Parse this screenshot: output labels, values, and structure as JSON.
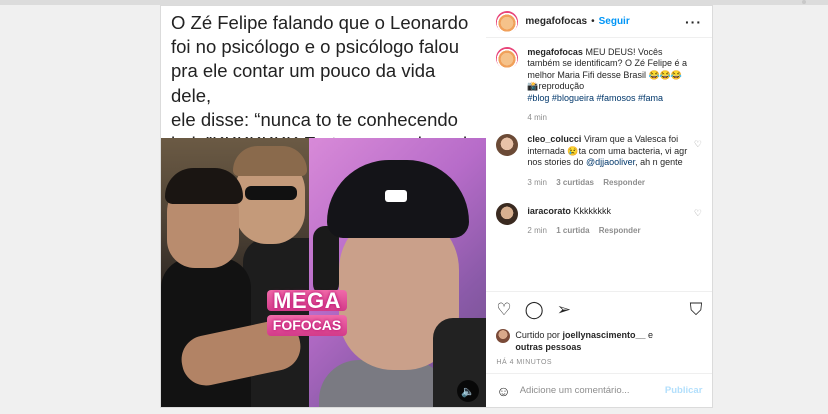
{
  "media": {
    "caption_lines": [
      "O Zé Felipe falando que o Leonardo",
      "foi no psicólogo e o psicólogo falou",
      "pra ele contar um pouco da vida dele,",
      "ele disse: “nunca to te conhecendo",
      "hoje”KKKKKKK Eu to passando mal"
    ],
    "watermark_line1": "MEGA",
    "watermark_line2": "FOFOCAS",
    "sound_icon": "🔈"
  },
  "header": {
    "username": "megafofocas",
    "dot": "•",
    "follow_label": "Seguir",
    "more_icon": "···"
  },
  "post_caption": {
    "username": "megafofocas",
    "text": "MEU DEUS! Vocês também se identificam? O Zé Felipe é a melhor Maria Fifi desse Brasil 😂😂😂",
    "repost": "📸reprodução",
    "hashtags": "#blog #blogueira #famosos #fama",
    "time": "4 min"
  },
  "comments": [
    {
      "username": "cleo_colucci",
      "text_before": "Viram que a Valesca foi internada 😢ta com uma bacteria, vi agr nos stories do",
      "mention": "@djjaooliver",
      "text_after": ", ah n gente",
      "time": "3 min",
      "likes": "3 curtidas",
      "reply": "Responder"
    },
    {
      "username": "iaracorato",
      "text": "Kkkkkkkk",
      "time": "2 min",
      "likes": "1 curtida",
      "reply": "Responder"
    }
  ],
  "actions": {
    "liked_prefix": "Curtido por",
    "liked_user": "joellynascimento__",
    "liked_mid": "e",
    "liked_others": "outras pessoas",
    "time": "HÁ 4 MINUTOS"
  },
  "add_comment": {
    "emoji_icon": "☺",
    "placeholder": "Adicione um comentário...",
    "publish_label": "Publicar"
  }
}
